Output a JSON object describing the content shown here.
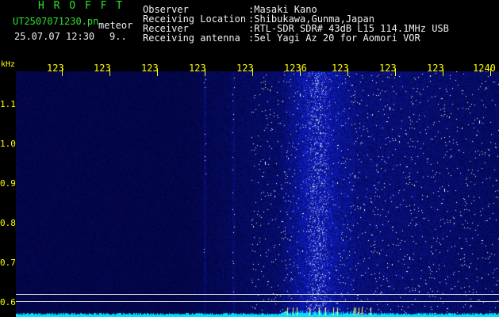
{
  "header": {
    "logo": "H R O F F T",
    "file_name": "UT2507071230.pn",
    "mode_label": "meteor",
    "datetime": "25.07.07 12:30",
    "count": "9..",
    "fields": [
      {
        "label": "Observer",
        "value": ":Masaki Kano"
      },
      {
        "label": "Receiving Location",
        "value": ":Shibukawa,Gunma,Japan"
      },
      {
        "label": "Receiver",
        "value": ":RTL-SDR SDR# 43dB L15 114.1MHz USB"
      },
      {
        "label": "Receiving antenna",
        "value": ":5el Yagi Az 20 for Aomori VOR"
      }
    ]
  },
  "axis": {
    "unit": "kHz",
    "y_ticks": [
      "1.1",
      "1.0",
      "0.9",
      "0.8",
      "0.7",
      "0.6"
    ],
    "x_ticks": [
      "123",
      "123",
      "123",
      "123",
      "123",
      "1236",
      "123",
      "123",
      "123",
      "1240"
    ]
  },
  "colors": {
    "header_green": "#2fe02f",
    "axis_yellow": "#ffff00",
    "text_white": "#f0f0f0",
    "signal_cyan": "#00e0ff"
  }
}
